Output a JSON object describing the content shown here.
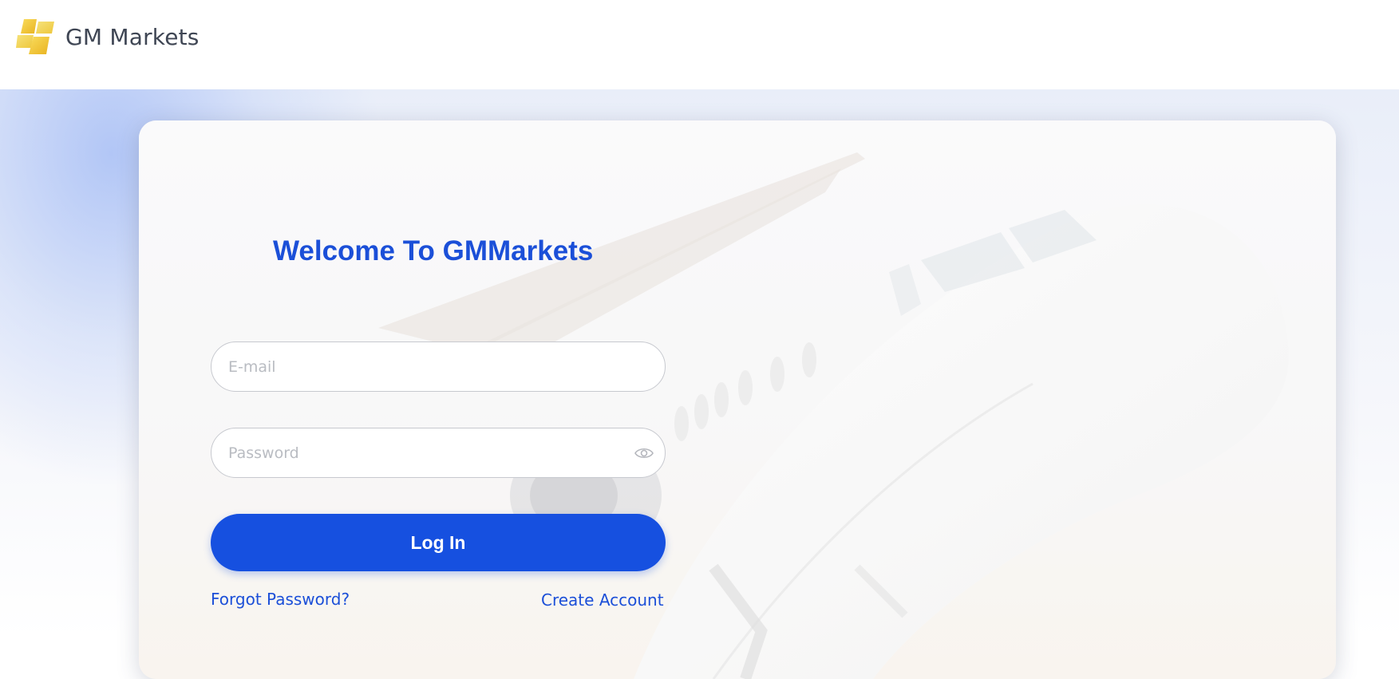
{
  "header": {
    "brand": "GM Markets",
    "logo_icon": "gm-markets-logo-icon"
  },
  "login": {
    "title": "Welcome To GMMarkets",
    "email_placeholder": "E-mail",
    "password_placeholder": "Password",
    "password_toggle_icon": "eye-icon",
    "submit_label": "Log In",
    "forgot_label": "Forgot Password?",
    "create_label": "Create Account"
  },
  "colors": {
    "accent": "#1650e0",
    "title": "#1b4fd8",
    "logo_yellow": "#f2c530"
  }
}
